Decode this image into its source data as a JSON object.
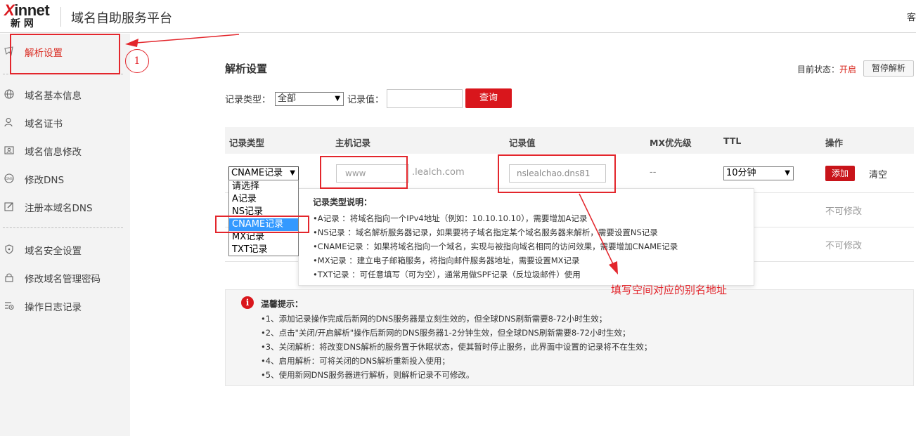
{
  "header": {
    "logo_latin": "innet",
    "logo_x": "X",
    "logo_cn": "新 网",
    "app_title": "域名自助服务平台",
    "right_text": "客"
  },
  "sidebar": {
    "items": [
      {
        "label": "解析设置",
        "icon": "cursor-icon",
        "active": true
      },
      {
        "label": "域名基本信息",
        "icon": "globe-icon"
      },
      {
        "label": "域名证书",
        "icon": "user-icon"
      },
      {
        "label": "域名信息修改",
        "icon": "profile-card-icon"
      },
      {
        "label": "修改DNS",
        "icon": "dns-icon"
      },
      {
        "label": "注册本域名DNS",
        "icon": "edit-icon"
      },
      {
        "label": "域名安全设置",
        "icon": "shield-icon"
      },
      {
        "label": "修改域名管理密码",
        "icon": "lock-icon"
      },
      {
        "label": "操作日志记录",
        "icon": "log-icon"
      }
    ]
  },
  "main": {
    "title": "解析设置",
    "status_label": "目前状态：",
    "status_value": "开启",
    "pause_button": "暂停解析",
    "filter": {
      "type_label": "记录类型：",
      "type_value": "全部",
      "value_label": "记录值：",
      "value_input": "",
      "query_button": "查询"
    },
    "table": {
      "headers": [
        "记录类型",
        "主机记录",
        "记录值",
        "MX优先级",
        "TTL",
        "操作"
      ],
      "new_row": {
        "type_value": "CNAME记录",
        "host_value": "www",
        "host_suffix": ".lealch.com",
        "record_value": "nslealchao.dns81",
        "mx_value": "--",
        "ttl_value": "10分钟",
        "add_button": "添加",
        "clear_link": "清空"
      },
      "type_options": [
        "请选择",
        "A记录",
        "NS记录",
        "CNAME记录",
        "MX记录",
        "TXT记录"
      ],
      "selected_option": "CNAME记录",
      "readonly_rows": [
        "不可修改",
        "不可修改"
      ]
    },
    "type_help": {
      "title": "记录类型说明：",
      "lines": [
        "•A记录 ：将域名指向一个IPv4地址（例如：10.10.10.10），需要增加A记录",
        "•NS记录 ：域名解析服务器记录，如果要将子域名指定某个域名服务器来解析，需要设置NS记录",
        "•CNAME记录 ：如果将域名指向一个域名，实现与被指向域名相同的访问效果，需要增加CNAME记录",
        "•MX记录 ：建立电子邮箱服务，将指向邮件服务器地址，需要设置MX记录",
        "•TXT记录 ：可任意填写（可为空），通常用做SPF记录（反垃圾邮件）使用"
      ]
    },
    "notice": {
      "icon": "i",
      "title": "温馨提示：",
      "lines": [
        "•1、添加记录操作完成后新网的DNS服务器是立刻生效的，但全球DNS刷新需要8-72小时生效；",
        "•2、点击\"关闭/开启解析\"操作后新网的DNS服务器1-2分钟生效，但全球DNS刷新需要8-72小时生效；",
        "•3、关闭解析：将改变DNS解析的服务置于休眠状态，使其暂时停止服务，此界面中设置的记录将不在生效；",
        "•4、启用解析：可将关闭的DNS解析重新投入使用；",
        "•5、使用新网DNS服务器进行解析，则解析记录不可修改。"
      ]
    }
  },
  "annotations": {
    "step_number": "1",
    "callout_text": "填写空间对应的别名地址",
    "color": "#e3262c"
  },
  "colors": {
    "brand_red": "#d9161c",
    "selected_blue": "#3399ff",
    "sidebar_bg": "#f3f3f3"
  }
}
